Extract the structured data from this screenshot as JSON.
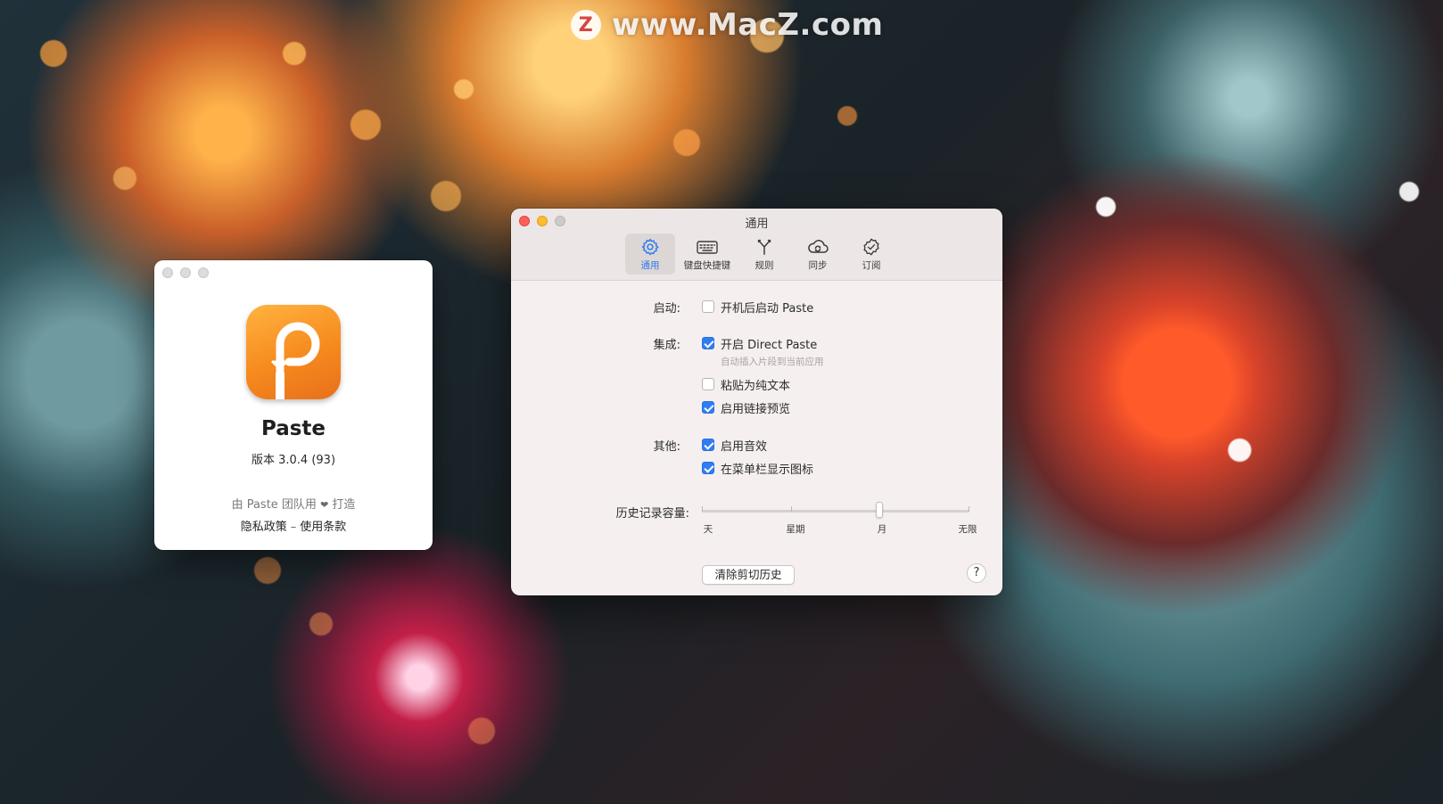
{
  "watermark": {
    "logo": "Z",
    "text": "www.MacZ.com"
  },
  "about": {
    "app_name": "Paste",
    "version": "版本 3.0.4 (93)",
    "credit_prefix": "由 Paste 团队用",
    "credit_suffix": "打造",
    "privacy_link": "隐私政策",
    "separator": "–",
    "terms_link": "使用条款",
    "icon": "paste-app-icon"
  },
  "prefs": {
    "title": "通用",
    "tabs": [
      {
        "label": "通用",
        "icon": "gear-icon"
      },
      {
        "label": "键盘快捷键",
        "icon": "keyboard-icon"
      },
      {
        "label": "规则",
        "icon": "rules-icon"
      },
      {
        "label": "同步",
        "icon": "cloud-sync-icon"
      },
      {
        "label": "订阅",
        "icon": "badge-check-icon"
      }
    ],
    "active_tab": "通用",
    "startup_label": "启动:",
    "launch_at_login": {
      "label": "开机后启动 Paste",
      "checked": false
    },
    "integration_label": "集成:",
    "direct_paste": {
      "label": "开启 Direct Paste",
      "checked": true,
      "hint": "自动插入片段到当前应用"
    },
    "plain_text": {
      "label": "粘贴为纯文本",
      "checked": false
    },
    "link_preview": {
      "label": "启用链接预览",
      "checked": true
    },
    "other_label": "其他:",
    "sound_effects": {
      "label": "启用音效",
      "checked": true
    },
    "menu_bar_icon": {
      "label": "在菜单栏显示图标",
      "checked": true
    },
    "history_label": "历史记录容量:",
    "history_stops": [
      "天",
      "星期",
      "月",
      "无限"
    ],
    "history_value": "月",
    "clear_button": "清除剪切历史",
    "help_button": "?"
  },
  "colors": {
    "accent": "#2f7df6",
    "close": "#fe5f57",
    "minimize": "#febc2e",
    "zoom_inactive": "#cfcaca"
  }
}
